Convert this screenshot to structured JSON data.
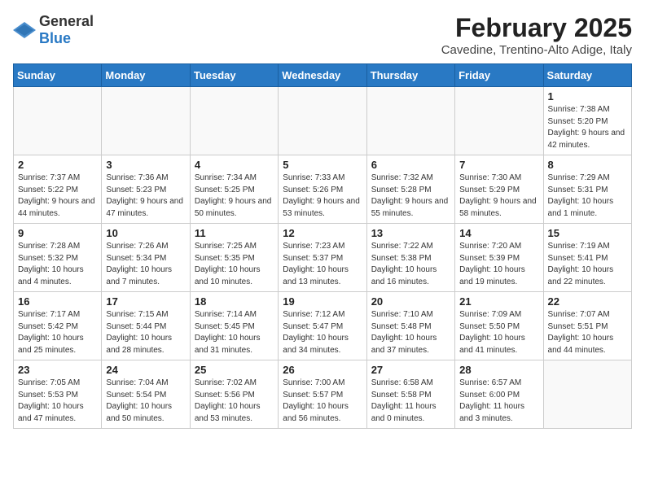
{
  "header": {
    "logo_general": "General",
    "logo_blue": "Blue",
    "month_year": "February 2025",
    "location": "Cavedine, Trentino-Alto Adige, Italy"
  },
  "weekdays": [
    "Sunday",
    "Monday",
    "Tuesday",
    "Wednesday",
    "Thursday",
    "Friday",
    "Saturday"
  ],
  "weeks": [
    [
      {
        "day": "",
        "info": ""
      },
      {
        "day": "",
        "info": ""
      },
      {
        "day": "",
        "info": ""
      },
      {
        "day": "",
        "info": ""
      },
      {
        "day": "",
        "info": ""
      },
      {
        "day": "",
        "info": ""
      },
      {
        "day": "1",
        "info": "Sunrise: 7:38 AM\nSunset: 5:20 PM\nDaylight: 9 hours and 42 minutes."
      }
    ],
    [
      {
        "day": "2",
        "info": "Sunrise: 7:37 AM\nSunset: 5:22 PM\nDaylight: 9 hours and 44 minutes."
      },
      {
        "day": "3",
        "info": "Sunrise: 7:36 AM\nSunset: 5:23 PM\nDaylight: 9 hours and 47 minutes."
      },
      {
        "day": "4",
        "info": "Sunrise: 7:34 AM\nSunset: 5:25 PM\nDaylight: 9 hours and 50 minutes."
      },
      {
        "day": "5",
        "info": "Sunrise: 7:33 AM\nSunset: 5:26 PM\nDaylight: 9 hours and 53 minutes."
      },
      {
        "day": "6",
        "info": "Sunrise: 7:32 AM\nSunset: 5:28 PM\nDaylight: 9 hours and 55 minutes."
      },
      {
        "day": "7",
        "info": "Sunrise: 7:30 AM\nSunset: 5:29 PM\nDaylight: 9 hours and 58 minutes."
      },
      {
        "day": "8",
        "info": "Sunrise: 7:29 AM\nSunset: 5:31 PM\nDaylight: 10 hours and 1 minute."
      }
    ],
    [
      {
        "day": "9",
        "info": "Sunrise: 7:28 AM\nSunset: 5:32 PM\nDaylight: 10 hours and 4 minutes."
      },
      {
        "day": "10",
        "info": "Sunrise: 7:26 AM\nSunset: 5:34 PM\nDaylight: 10 hours and 7 minutes."
      },
      {
        "day": "11",
        "info": "Sunrise: 7:25 AM\nSunset: 5:35 PM\nDaylight: 10 hours and 10 minutes."
      },
      {
        "day": "12",
        "info": "Sunrise: 7:23 AM\nSunset: 5:37 PM\nDaylight: 10 hours and 13 minutes."
      },
      {
        "day": "13",
        "info": "Sunrise: 7:22 AM\nSunset: 5:38 PM\nDaylight: 10 hours and 16 minutes."
      },
      {
        "day": "14",
        "info": "Sunrise: 7:20 AM\nSunset: 5:39 PM\nDaylight: 10 hours and 19 minutes."
      },
      {
        "day": "15",
        "info": "Sunrise: 7:19 AM\nSunset: 5:41 PM\nDaylight: 10 hours and 22 minutes."
      }
    ],
    [
      {
        "day": "16",
        "info": "Sunrise: 7:17 AM\nSunset: 5:42 PM\nDaylight: 10 hours and 25 minutes."
      },
      {
        "day": "17",
        "info": "Sunrise: 7:15 AM\nSunset: 5:44 PM\nDaylight: 10 hours and 28 minutes."
      },
      {
        "day": "18",
        "info": "Sunrise: 7:14 AM\nSunset: 5:45 PM\nDaylight: 10 hours and 31 minutes."
      },
      {
        "day": "19",
        "info": "Sunrise: 7:12 AM\nSunset: 5:47 PM\nDaylight: 10 hours and 34 minutes."
      },
      {
        "day": "20",
        "info": "Sunrise: 7:10 AM\nSunset: 5:48 PM\nDaylight: 10 hours and 37 minutes."
      },
      {
        "day": "21",
        "info": "Sunrise: 7:09 AM\nSunset: 5:50 PM\nDaylight: 10 hours and 41 minutes."
      },
      {
        "day": "22",
        "info": "Sunrise: 7:07 AM\nSunset: 5:51 PM\nDaylight: 10 hours and 44 minutes."
      }
    ],
    [
      {
        "day": "23",
        "info": "Sunrise: 7:05 AM\nSunset: 5:53 PM\nDaylight: 10 hours and 47 minutes."
      },
      {
        "day": "24",
        "info": "Sunrise: 7:04 AM\nSunset: 5:54 PM\nDaylight: 10 hours and 50 minutes."
      },
      {
        "day": "25",
        "info": "Sunrise: 7:02 AM\nSunset: 5:56 PM\nDaylight: 10 hours and 53 minutes."
      },
      {
        "day": "26",
        "info": "Sunrise: 7:00 AM\nSunset: 5:57 PM\nDaylight: 10 hours and 56 minutes."
      },
      {
        "day": "27",
        "info": "Sunrise: 6:58 AM\nSunset: 5:58 PM\nDaylight: 11 hours and 0 minutes."
      },
      {
        "day": "28",
        "info": "Sunrise: 6:57 AM\nSunset: 6:00 PM\nDaylight: 11 hours and 3 minutes."
      },
      {
        "day": "",
        "info": ""
      }
    ]
  ]
}
